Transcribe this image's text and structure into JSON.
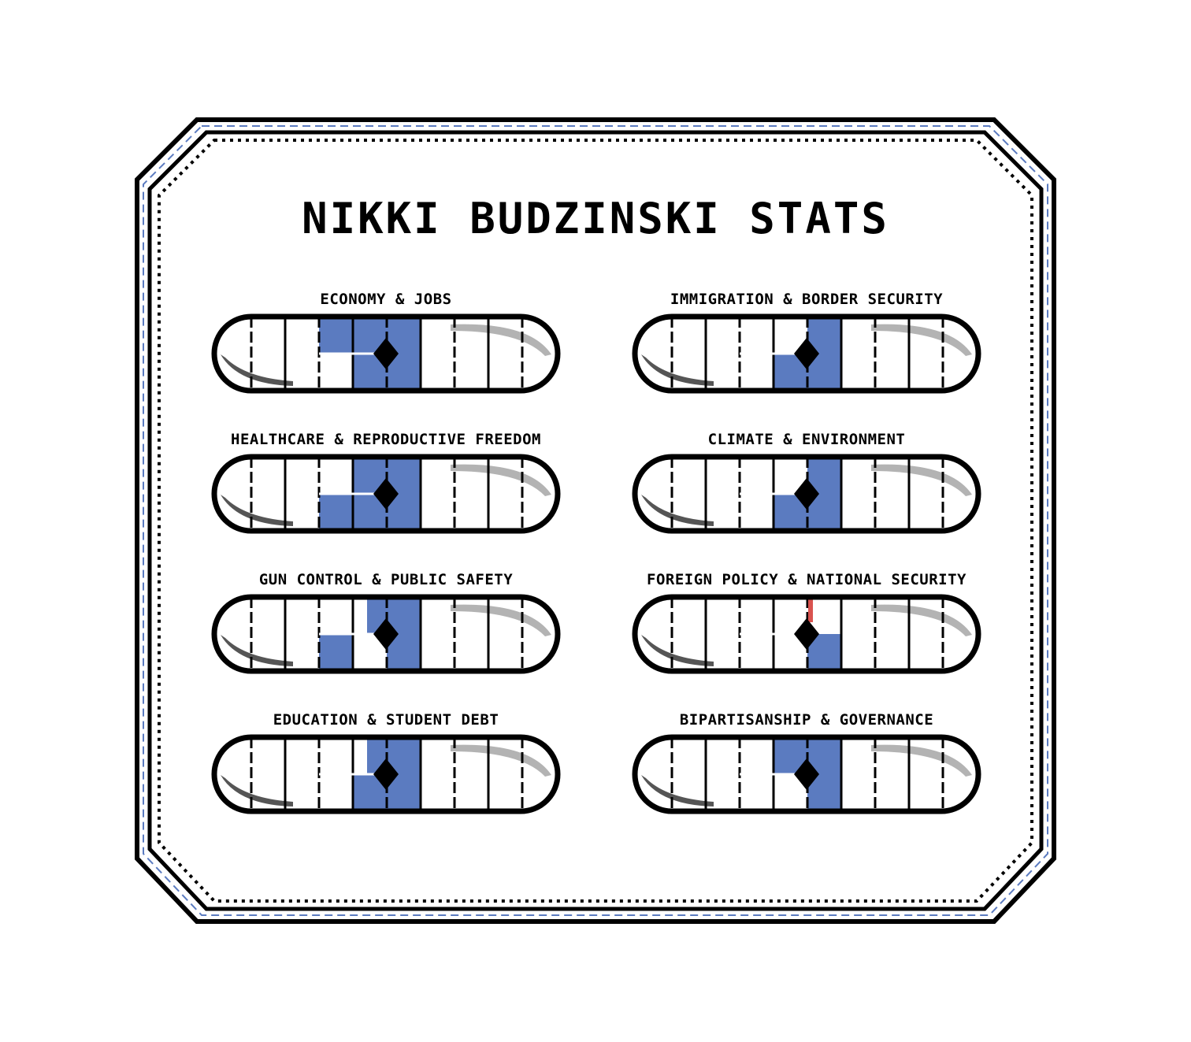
{
  "title": "NIKKI BUDZINSKI STATS",
  "colors": {
    "fill": "#5b7bc0",
    "outline": "#000000",
    "frame_accent": "#5b7bc0",
    "marker": "#000000",
    "alert": "#d9534f",
    "swoosh_dark": "#555555",
    "swoosh_light": "#b3b3b3"
  },
  "stats": [
    {
      "label": "ECONOMY & JOBS",
      "cols_full": [
        4,
        5
      ],
      "col_half": 3,
      "half_top": true,
      "red": false
    },
    {
      "label": "IMMIGRATION & BORDER SECURITY",
      "cols_full": [
        5
      ],
      "col_half": 4,
      "half_top": false,
      "red": false
    },
    {
      "label": "HEALTHCARE & REPRODUCTIVE FREEDOM",
      "cols_full": [
        4,
        5
      ],
      "col_half": 3,
      "half_top": false,
      "red": false
    },
    {
      "label": "CLIMATE & ENVIRONMENT",
      "cols_full": [
        5
      ],
      "col_half": 4,
      "half_top": false,
      "red": false
    },
    {
      "label": "GUN CONTROL & PUBLIC SAFETY",
      "cols_full": [
        5
      ],
      "col_half": 3,
      "half_top": false,
      "red": false,
      "partial_col": 4
    },
    {
      "label": "FOREIGN POLICY & NATIONAL SECURITY",
      "cols_full": [],
      "col_half": 5,
      "half_top": false,
      "red": true
    },
    {
      "label": "EDUCATION & STUDENT DEBT",
      "cols_full": [
        5
      ],
      "col_half": 4,
      "half_top": false,
      "red": false,
      "partial_col": 4
    },
    {
      "label": "BIPARTISANSHIP & GOVERNANCE",
      "cols_full": [
        5
      ],
      "col_half": 4,
      "half_top": true,
      "red": false
    }
  ]
}
